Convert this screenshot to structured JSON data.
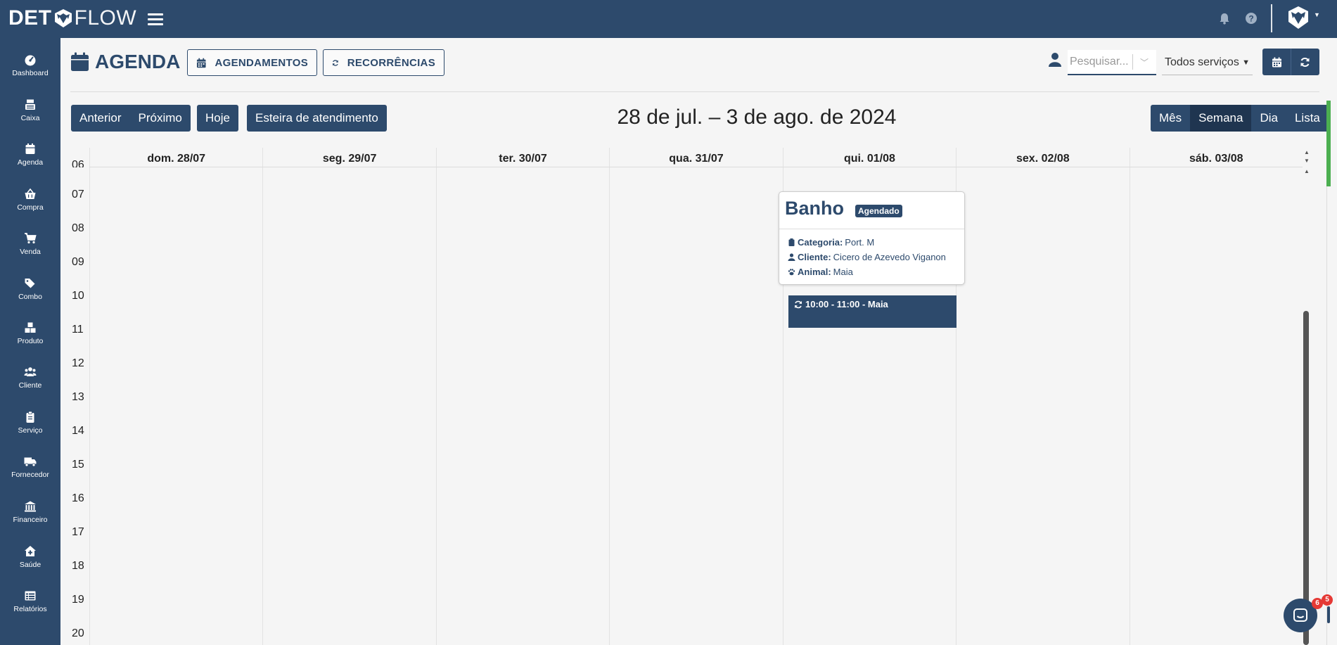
{
  "app": {
    "logo_left": "DET",
    "logo_right": "FLOW"
  },
  "sidebar": {
    "items": [
      {
        "label": "Dashboard",
        "icon": "dashboard-icon"
      },
      {
        "label": "Caixa",
        "icon": "cash-register-icon"
      },
      {
        "label": "Agenda",
        "icon": "calendar-icon"
      },
      {
        "label": "Compra",
        "icon": "basket-icon"
      },
      {
        "label": "Venda",
        "icon": "cart-icon"
      },
      {
        "label": "Combo",
        "icon": "tags-icon"
      },
      {
        "label": "Produto",
        "icon": "boxes-icon"
      },
      {
        "label": "Cliente",
        "icon": "users-icon"
      },
      {
        "label": "Serviço",
        "icon": "clipboard-icon"
      },
      {
        "label": "Fornecedor",
        "icon": "truck-icon"
      },
      {
        "label": "Financeiro",
        "icon": "bank-icon"
      },
      {
        "label": "Saúde",
        "icon": "medical-house-icon"
      },
      {
        "label": "Relatórios",
        "icon": "table-icon"
      }
    ]
  },
  "header": {
    "title": "AGENDA",
    "agendamentos_label": "AGENDAMENTOS",
    "recorrencias_label": "RECORRÊNCIAS",
    "search_placeholder": "Pesquisar...",
    "service_filter": "Todos serviços"
  },
  "toolbar": {
    "prev_label": "Anterior",
    "next_label": "Próximo",
    "today_label": "Hoje",
    "queue_label": "Esteira de atendimento",
    "range_title": "28 de jul. – 3 de ago. de 2024",
    "views": [
      "Mês",
      "Semana",
      "Dia",
      "Lista"
    ],
    "active_view": "Semana"
  },
  "calendar": {
    "days": [
      "dom. 28/07",
      "seg. 29/07",
      "ter. 30/07",
      "qua. 31/07",
      "qui. 01/08",
      "sex. 02/08",
      "sáb. 03/08"
    ],
    "hours": [
      "06",
      "07",
      "08",
      "09",
      "10",
      "11",
      "12",
      "13",
      "14",
      "15",
      "16",
      "17",
      "18",
      "19",
      "20"
    ]
  },
  "popover": {
    "title": "Banho",
    "status": "Agendado",
    "categoria_label": "Categoria:",
    "categoria_value": "Port. M",
    "cliente_label": "Cliente:",
    "cliente_value": "Cicero de Azevedo Viganon",
    "animal_label": "Animal:",
    "animal_value": "Maia"
  },
  "event": {
    "text": "10:00 - 11:00 - Maia"
  },
  "chat": {
    "badge_count": "6",
    "badge_count_2": "5"
  },
  "colors": {
    "primary": "#2d4a6c",
    "accent_green": "#4caf50",
    "badge_red": "#e53935"
  }
}
